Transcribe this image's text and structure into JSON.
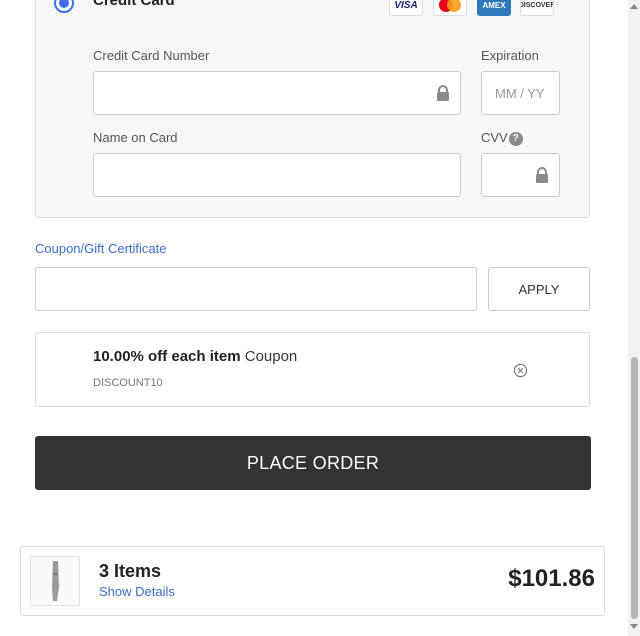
{
  "payment": {
    "method_label": "Credit Card",
    "card_brands": [
      "VISA",
      "MC",
      "AMEX",
      "DISCOVER"
    ],
    "card_number_label": "Credit Card Number",
    "card_number_value": "",
    "expiration_label": "Expiration",
    "expiration_placeholder": "MM / YY",
    "name_label": "Name on Card",
    "name_value": "",
    "cvv_label": "CVV",
    "cvv_value": ""
  },
  "coupon": {
    "link_label": "Coupon/Gift Certificate",
    "input_value": "",
    "apply_label": "APPLY",
    "applied": {
      "bold": "10.00% off each item",
      "suffix": " Coupon",
      "code": "DISCOUNT10"
    }
  },
  "place_order_label": "PLACE ORDER",
  "summary": {
    "items": "3 Items",
    "details_link": "Show Details",
    "total": "$101.86"
  },
  "colors": {
    "accent": "#3b6ee8",
    "link": "#3b6ec9",
    "button_dark": "#333333"
  }
}
